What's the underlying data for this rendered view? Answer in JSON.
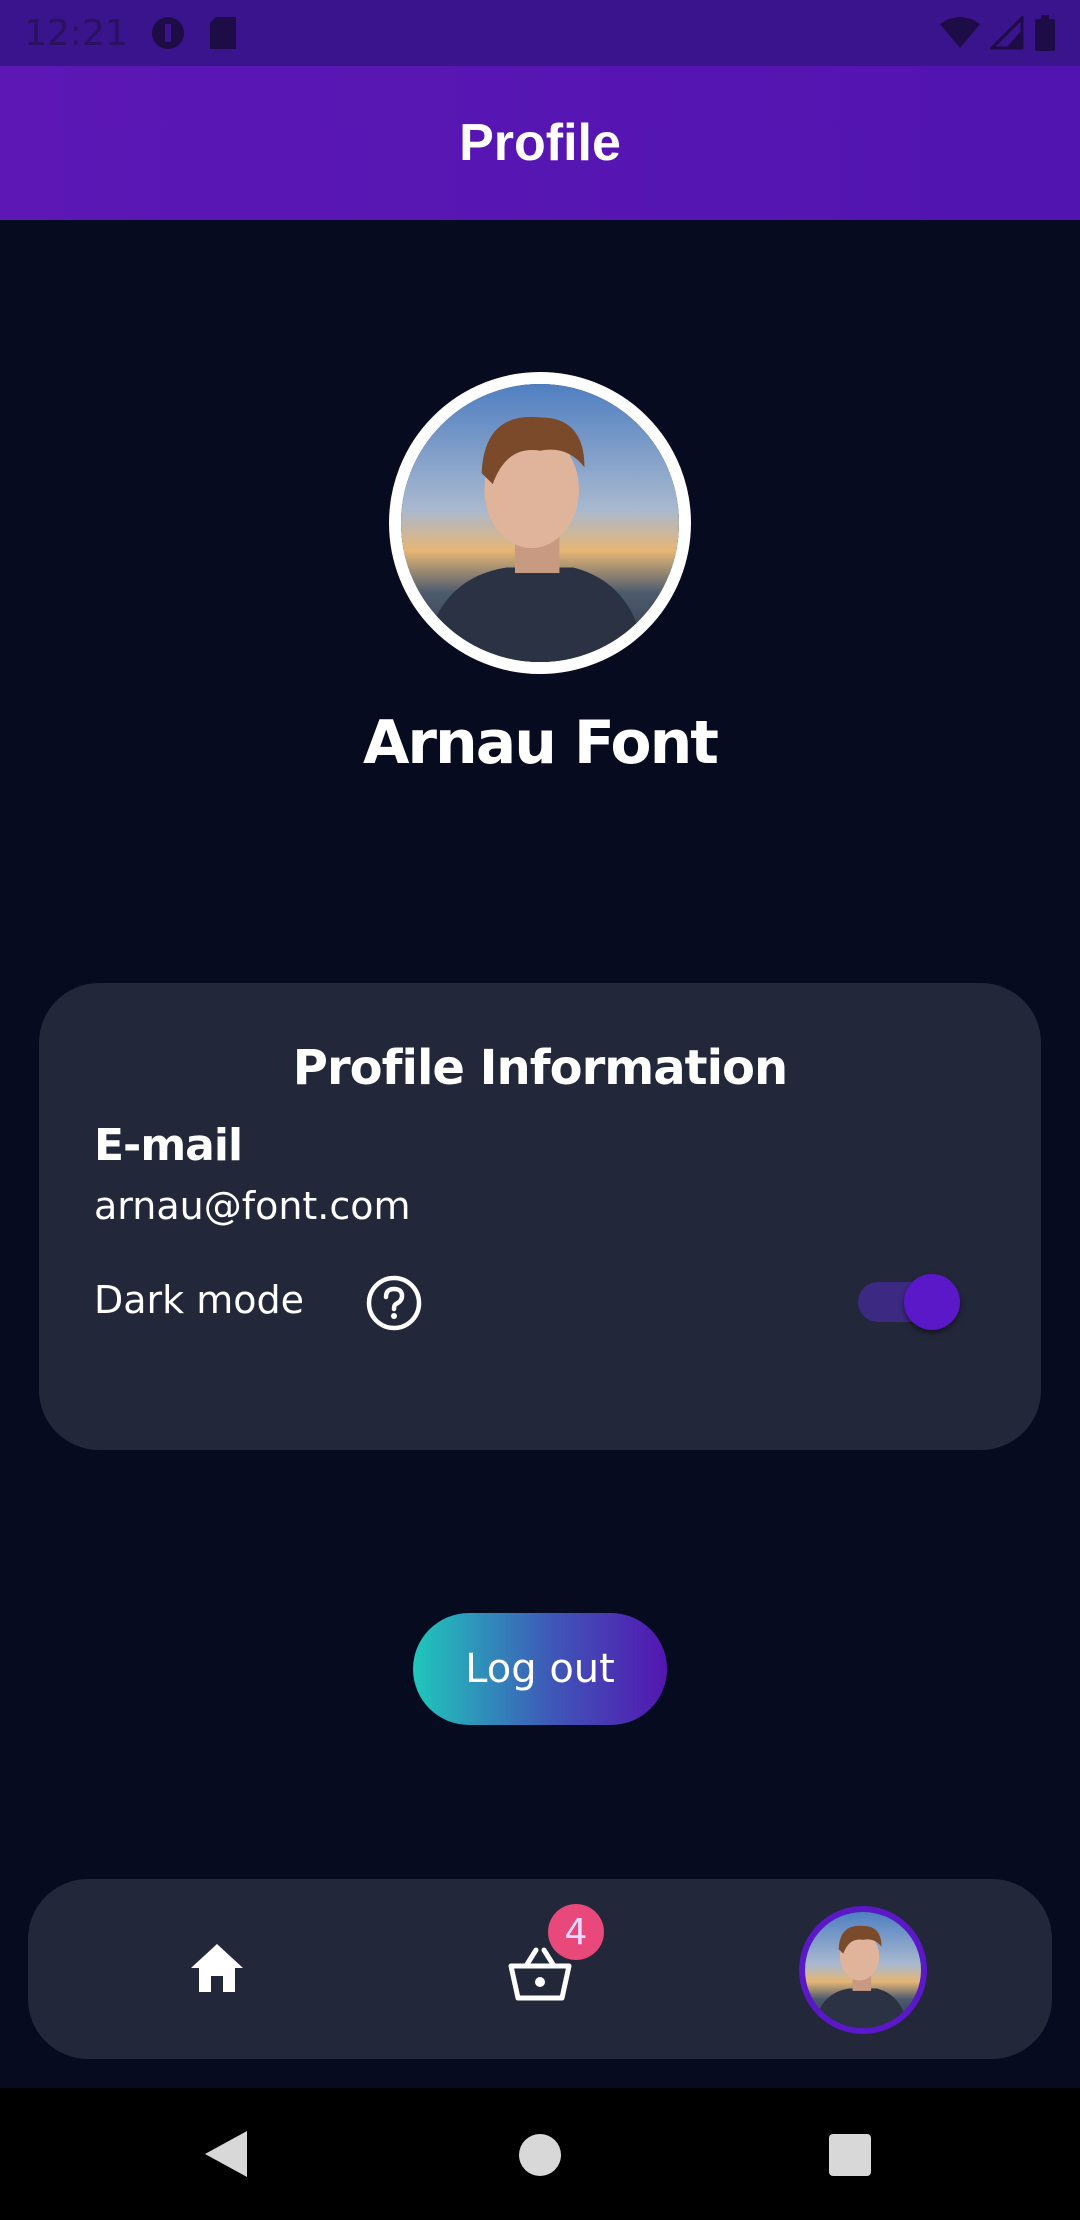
{
  "status_bar": {
    "time": "12:21",
    "icons": [
      "vpn-icon",
      "sd-card-icon",
      "wifi-icon",
      "signal-icon",
      "battery-icon"
    ]
  },
  "app_bar": {
    "title": "Profile"
  },
  "profile": {
    "name": "Arnau Font",
    "avatar": "profile-photo"
  },
  "card": {
    "title": "Profile Information",
    "email_label": "E-mail",
    "email_value": "arnau@font.com",
    "dark_mode_label": "Dark mode",
    "dark_mode_on": true
  },
  "logout_label": "Log out",
  "bottom_nav": {
    "items": [
      {
        "icon": "home-icon"
      },
      {
        "icon": "basket-icon",
        "badge": "4"
      },
      {
        "icon": "avatar"
      }
    ]
  },
  "colors": {
    "background": "#060b20",
    "app_bar": "#5114b0",
    "card": "#23273a",
    "accent": "#5a18c9",
    "badge": "#e8487a",
    "button_gradient_start": "#1fc7bb",
    "button_gradient_end": "#5316b0"
  }
}
